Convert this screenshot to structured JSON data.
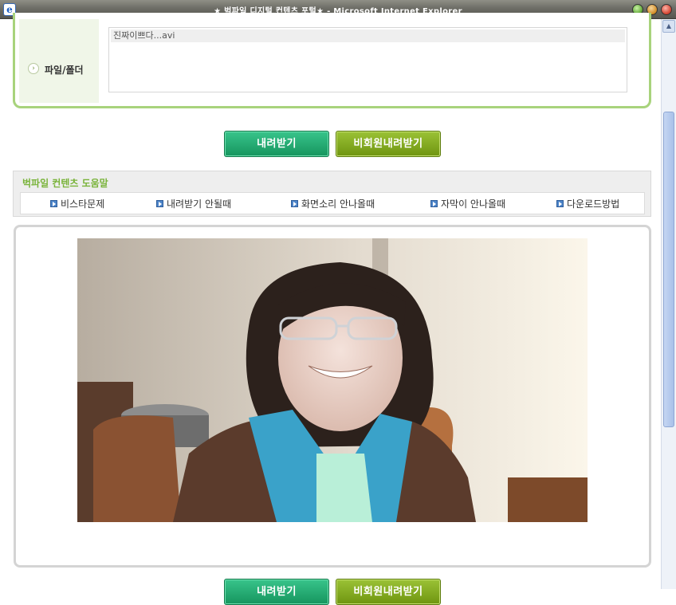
{
  "window": {
    "title": "★ 벅파일 디지털 컨텐츠 포털★ - Microsoft Internet Explorer",
    "app_icon": "ie-icon"
  },
  "file_section": {
    "label": "파일/폴더",
    "files": [
      "진짜이쁘다...avi"
    ]
  },
  "buttons": {
    "download": "내려받기",
    "guest_download": "비회원내려받기"
  },
  "help": {
    "title": "벅파일 컨텐츠 도움말",
    "links": [
      "비스타문제",
      "내려받기 안될때",
      "화면소리 안나올때",
      "자막이 안나올때",
      "다운로드방법"
    ]
  },
  "colors": {
    "accent_green": "#a8d37c",
    "download_button": "#16955e",
    "guest_button": "#6f9510",
    "help_title": "#79b33a"
  }
}
